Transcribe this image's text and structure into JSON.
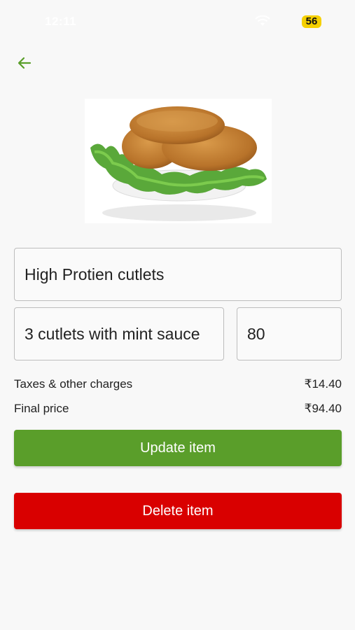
{
  "status_bar": {
    "time": "12:11",
    "battery": "56",
    "battery_color": "#f5d000"
  },
  "icons": {
    "back": "arrow-left-icon",
    "wifi": "wifi-icon"
  },
  "item": {
    "name_value": "High Protien cutlets",
    "description_value": "3 cutlets with mint sauce",
    "price_value": "80"
  },
  "charges": {
    "taxes_label": "Taxes & other charges",
    "taxes_value": "₹14.40",
    "final_label": "Final price",
    "final_value": "₹94.40"
  },
  "actions": {
    "update_label": "Update item",
    "delete_label": "Delete item"
  },
  "colors": {
    "accent_green": "#5a9e2a",
    "danger_red": "#d90000",
    "background": "#f8f8f8"
  }
}
